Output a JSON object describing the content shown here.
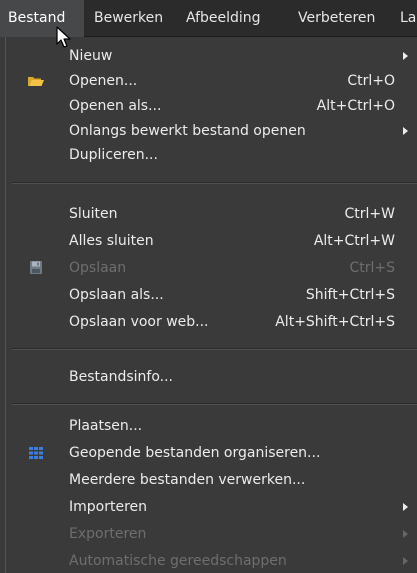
{
  "menubar": {
    "items": [
      {
        "label": "Bestand"
      },
      {
        "label": "Bewerken"
      },
      {
        "label": "Afbeelding"
      },
      {
        "label": "Verbeteren"
      },
      {
        "label": "La"
      }
    ]
  },
  "menu": {
    "items": [
      {
        "label": "Nieuw",
        "shortcut": "",
        "submenu": true
      },
      {
        "label": "Openen...",
        "shortcut": "Ctrl+O",
        "icon": "folder-icon"
      },
      {
        "label": "Openen als...",
        "shortcut": "Alt+Ctrl+O"
      },
      {
        "label": "Onlangs bewerkt bestand openen",
        "shortcut": "",
        "submenu": true
      },
      {
        "label": "Dupliceren...",
        "shortcut": ""
      },
      {
        "label": "Sluiten",
        "shortcut": "Ctrl+W"
      },
      {
        "label": "Alles sluiten",
        "shortcut": "Alt+Ctrl+W"
      },
      {
        "label": "Opslaan",
        "shortcut": "Ctrl+S",
        "disabled": true,
        "icon": "floppy-disk-icon"
      },
      {
        "label": "Opslaan als...",
        "shortcut": "Shift+Ctrl+S"
      },
      {
        "label": "Opslaan voor web...",
        "shortcut": "Alt+Shift+Ctrl+S"
      },
      {
        "label": "Bestandsinfo...",
        "shortcut": ""
      },
      {
        "label": "Plaatsen...",
        "shortcut": ""
      },
      {
        "label": "Geopende bestanden organiseren...",
        "shortcut": "",
        "icon": "grid-icon"
      },
      {
        "label": "Meerdere bestanden verwerken...",
        "shortcut": ""
      },
      {
        "label": "Importeren",
        "shortcut": "",
        "submenu": true
      },
      {
        "label": "Exporteren",
        "shortcut": "",
        "submenu": true,
        "disabled": true
      },
      {
        "label": "Automatische gereedschappen",
        "shortcut": "",
        "submenu": true,
        "disabled": true
      }
    ]
  },
  "colors": {
    "menubar_bg": "#2b2b2b",
    "menu_bg": "#3a3a3a",
    "text": "#ececec",
    "disabled_text": "#6e6e6e",
    "folder_icon": "#f4c244",
    "grid_icon": "#3c7ee0"
  }
}
